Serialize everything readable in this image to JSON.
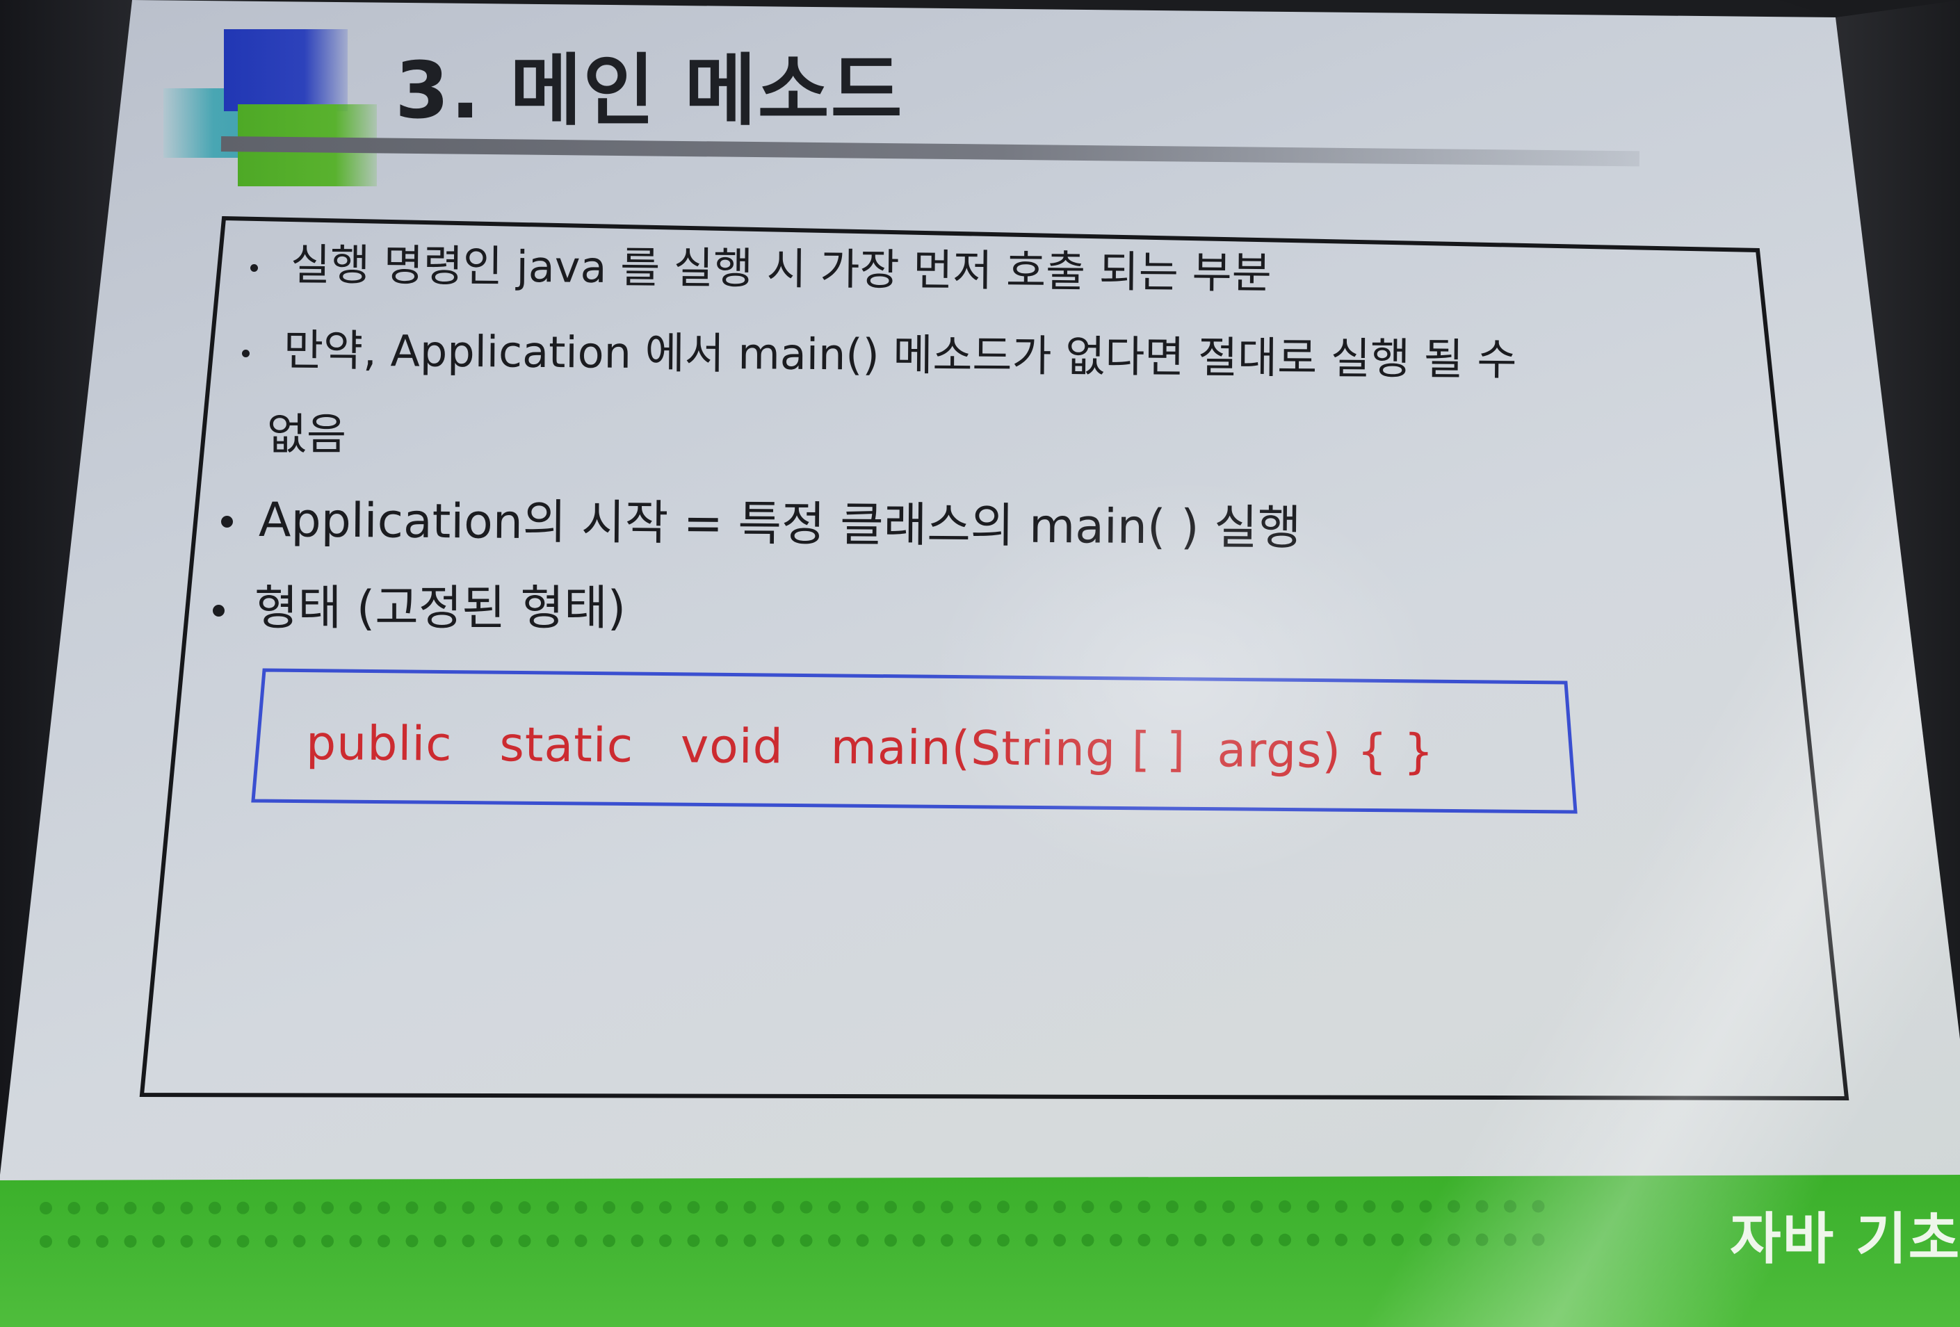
{
  "slide": {
    "title": "3. 메인 메소드",
    "bullets": [
      "실행 명령인 java 를 실행 시 가장 먼저 호출 되는 부분",
      "만약, Application 에서 main() 메소드가 없다면 절대로 실행 될 수",
      "없음",
      "Application의 시작 = 특정 클래스의 main( ) 실행",
      "형태 (고정된 형태)"
    ],
    "code": "public   static   void   main(String [ ]  args) { }",
    "footer_label": "자바 기초"
  },
  "colors": {
    "title_blue": "#2137b4",
    "title_green": "#4ea926",
    "title_teal": "#49a6b3",
    "footer_green": "#42b532",
    "code_red": "#cc2b30",
    "code_border_blue": "#3a4fd0",
    "frame_black": "#16171a"
  }
}
